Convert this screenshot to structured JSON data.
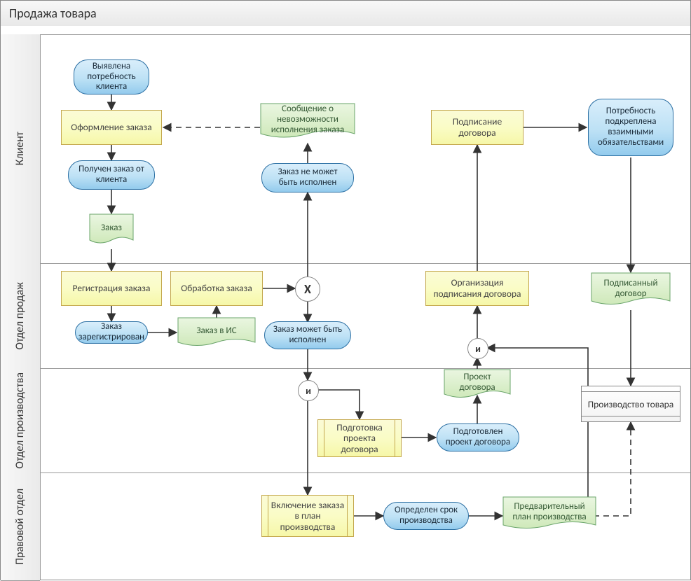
{
  "title": "Продажа товара",
  "lanes": {
    "lane1": "Клиент",
    "lane2": "Отдел продаж",
    "lane3": "Отдел производства",
    "lane4": "Правовой отдел"
  },
  "events": {
    "e_need": "Выявлена потребность клиента",
    "e_order_from_client": "Получен заказ от клиента",
    "e_cannot": "Заказ не может быть исполнен",
    "e_confirmed": "Потребность подкреплена взаимными обязательствами",
    "e_registered": "Заказ зарегистрирован",
    "e_can": "Заказ может быть исполнен",
    "e_proj_ready": "Подготовлен проект договора",
    "e_due_date": "Определен срок производства"
  },
  "tasks": {
    "t_order": "Оформление заказа",
    "t_sign": "Подписание договора",
    "t_register": "Регистрация заказа",
    "t_process": "Обработка заказа",
    "t_org_sign": "Организация подписания договора",
    "t_prep_proj": "Подготовка проекта договора",
    "t_plan": "Включение заказа в план производства"
  },
  "docs": {
    "d_cant_msg": "Сообщение о невозможности исполнения заказа",
    "d_order": "Заказ",
    "d_order_is": "Заказ в ИС",
    "d_proj": "Проект договора",
    "d_signed": "Подписанный договор",
    "d_plan": "Предварительный план производства"
  },
  "gateways": {
    "g_x": "X",
    "g_and1": "и",
    "g_and2": "и"
  },
  "subproc": {
    "sp_prod": "Производство товара"
  }
}
